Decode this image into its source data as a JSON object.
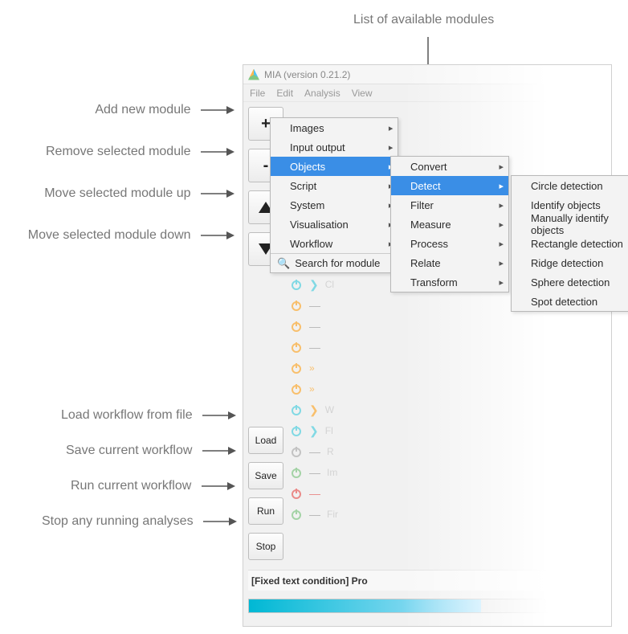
{
  "app": {
    "title": "MIA (version 0.21.2)"
  },
  "menubar": {
    "file": "File",
    "edit": "Edit",
    "analysis": "Analysis",
    "view": "View"
  },
  "annotations": {
    "add": "Add new module",
    "remove": "Remove selected module",
    "up": "Move selected module up",
    "down": "Move selected module down",
    "load": "Load workflow from file",
    "save": "Save current workflow",
    "run": "Run current workflow",
    "stop": "Stop any running analyses",
    "modules_header": "List of available modules"
  },
  "buttons": {
    "add": "+",
    "remove": "-",
    "load": "Load",
    "save": "Save",
    "run": "Run",
    "stop": "Stop"
  },
  "context1": {
    "items": [
      "Images",
      "Input output",
      "Objects",
      "Script",
      "System",
      "Visualisation",
      "Workflow"
    ],
    "search": "Search for module"
  },
  "context2": {
    "items": [
      "Convert",
      "Detect",
      "Filter",
      "Measure",
      "Process",
      "Relate",
      "Transform"
    ]
  },
  "context3": {
    "items": [
      "Circle detection",
      "Identify objects",
      "Manually identify objects",
      "Rectangle detection",
      "Ridge detection",
      "Sphere detection",
      "Spot detection"
    ]
  },
  "footer": {
    "fixed": "[Fixed text condition] Pro"
  },
  "rows": [
    {
      "power": "cyan",
      "icon": "chev-teal",
      "label": "Cl"
    },
    {
      "power": "orange",
      "icon": "minus",
      "label": ""
    },
    {
      "power": "orange",
      "icon": "minus",
      "label": ""
    },
    {
      "power": "orange",
      "icon": "minus",
      "label": ""
    },
    {
      "power": "orange",
      "icon": "dbl",
      "label": ""
    },
    {
      "power": "orange",
      "icon": "dbl",
      "label": ""
    },
    {
      "power": "cyan",
      "icon": "chev-o",
      "label": "W"
    },
    {
      "power": "cyan",
      "icon": "chev-teal",
      "label": "Fl"
    },
    {
      "power": "off",
      "icon": "minus",
      "label": "R"
    },
    {
      "power": "green",
      "icon": "minus",
      "label": "Im"
    },
    {
      "power": "red",
      "icon": "bar",
      "label": ""
    },
    {
      "power": "green",
      "icon": "minus",
      "label": "Fir"
    }
  ]
}
